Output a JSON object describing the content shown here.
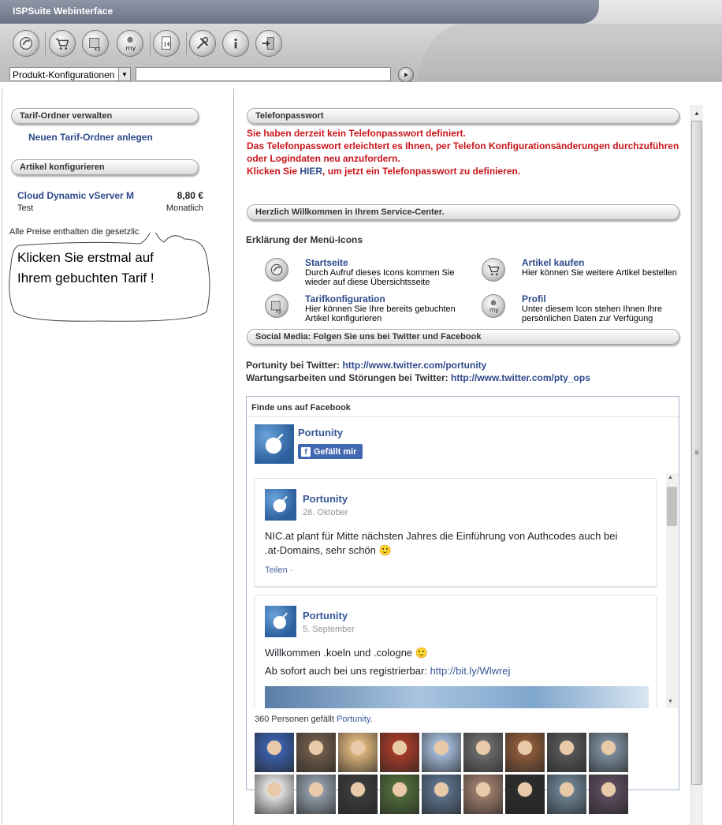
{
  "app": {
    "title": "ISPSuite Webinterface"
  },
  "toolbar": {
    "buttons": [
      {
        "name": "startseite",
        "icon": "globe-icon"
      },
      {
        "name": "artikel-kaufen",
        "icon": "cart-icon"
      },
      {
        "name": "tarifkonfiguration",
        "icon": "box-xy-icon"
      },
      {
        "name": "profil",
        "icon": "my-profile-icon"
      },
      {
        "name": "rechnungen",
        "icon": "euro-document-icon"
      },
      {
        "name": "werkzeuge",
        "icon": "tools-icon"
      },
      {
        "name": "info",
        "icon": "info-icon"
      },
      {
        "name": "logout",
        "icon": "exit-door-icon"
      }
    ],
    "select_value": "Produkt-Konfigurationen",
    "search_value": ""
  },
  "sidebar": {
    "tarif_section": "Tarif-Ordner verwalten",
    "new_folder_link": "Neuen Tarif-Ordner anlegen",
    "article_section": "Artikel konfigurieren",
    "article": {
      "name": "Cloud Dynamic vServer M",
      "price": "8,80 €",
      "folder": "Test",
      "period": "Monatlich"
    },
    "price_note": "Alle Preise enthalten die gesetzlic",
    "bubble_text": "Klicken Sie erstmal auf Ihrem gebuchten Tarif !"
  },
  "main": {
    "phone_section": "Telefonpasswort",
    "phone_line1": "Sie haben derzeit kein Telefonpasswort definiert.",
    "phone_line2": "Das Telefonpasswort erleichtert es Ihnen, per Telefon Konfigurationsänderungen durchzuführen",
    "phone_line3": "oder Logindaten neu anzufordern.",
    "phone_line4_pre": "Klicken Sie ",
    "phone_line4_link": "HIER",
    "phone_line4_post": ", um jetzt ein Telefonpasswort zu definieren.",
    "welcome_section": "Herzlich Willkommen in Ihrem Service-Center.",
    "menu_icons_heading": "Erklärung der Menü-Icons",
    "menu_icons": [
      {
        "title": "Startseite",
        "desc1": "Durch Aufruf dieses Icons kommen Sie",
        "desc2": "wieder auf diese Übersichtsseite",
        "icon": "globe-icon"
      },
      {
        "title": "Artikel kaufen",
        "desc1": "Hier können Sie weitere Artikel bestellen",
        "desc2": "",
        "icon": "cart-icon"
      },
      {
        "title": "Tarifkonfiguration",
        "desc1": "Hier können Sie Ihre bereits gebuchten",
        "desc2": "Artikel konfigurieren",
        "icon": "box-xy-icon"
      },
      {
        "title": "Profil",
        "desc1": "Unter diesem Icon stehen Ihnen Ihre",
        "desc2": "persönlichen Daten zur Verfügung",
        "icon": "my-profile-icon"
      }
    ],
    "social_section": "Social Media: Folgen Sie uns bei Twitter und Facebook",
    "twitter1_label": "Portunity bei Twitter: ",
    "twitter1_link": "http://www.twitter.com/portunity",
    "twitter2_label": "Wartungsarbeiten und Störungen bei Twitter: ",
    "twitter2_link": "http://www.twitter.com/pty_ops"
  },
  "facebook": {
    "heading": "Finde uns auf Facebook",
    "page_name": "Portunity",
    "like_button": "Gefällt mir",
    "posts": [
      {
        "page": "Portunity",
        "date": "28. Oktober",
        "text": "NIC.at plant für Mitte nächsten Jahres die Einführung von Authcodes auch bei .at-Domains, sehr schön 🙂",
        "action": "Teilen ·"
      },
      {
        "page": "Portunity",
        "date": "5. September",
        "text": "Willkommen .koeln und .cologne 🙂",
        "text2_pre": "Ab sofort auch bei uns registrierbar: ",
        "text2_link": "http://bit.ly/Wlwrej"
      }
    ],
    "likes_count_pre": "360 Personen gefällt ",
    "likes_count_link": "Portunity",
    "likes_count_post": ".",
    "avatar_colors": [
      "#3b5fa8",
      "#6d5a48",
      "#d9b27a",
      "#a33a2a",
      "#9fb7d4",
      "#6a6a6a",
      "#8a5a3a",
      "#555555",
      "#7a8a9a",
      "#e0e0e0",
      "#8e9aa6",
      "#3a3a3a",
      "#4f6a3a",
      "#5a6f8a",
      "#9a7a6a",
      "#2c2c2c",
      "#6a7f8f",
      "#5a4a5a"
    ]
  }
}
